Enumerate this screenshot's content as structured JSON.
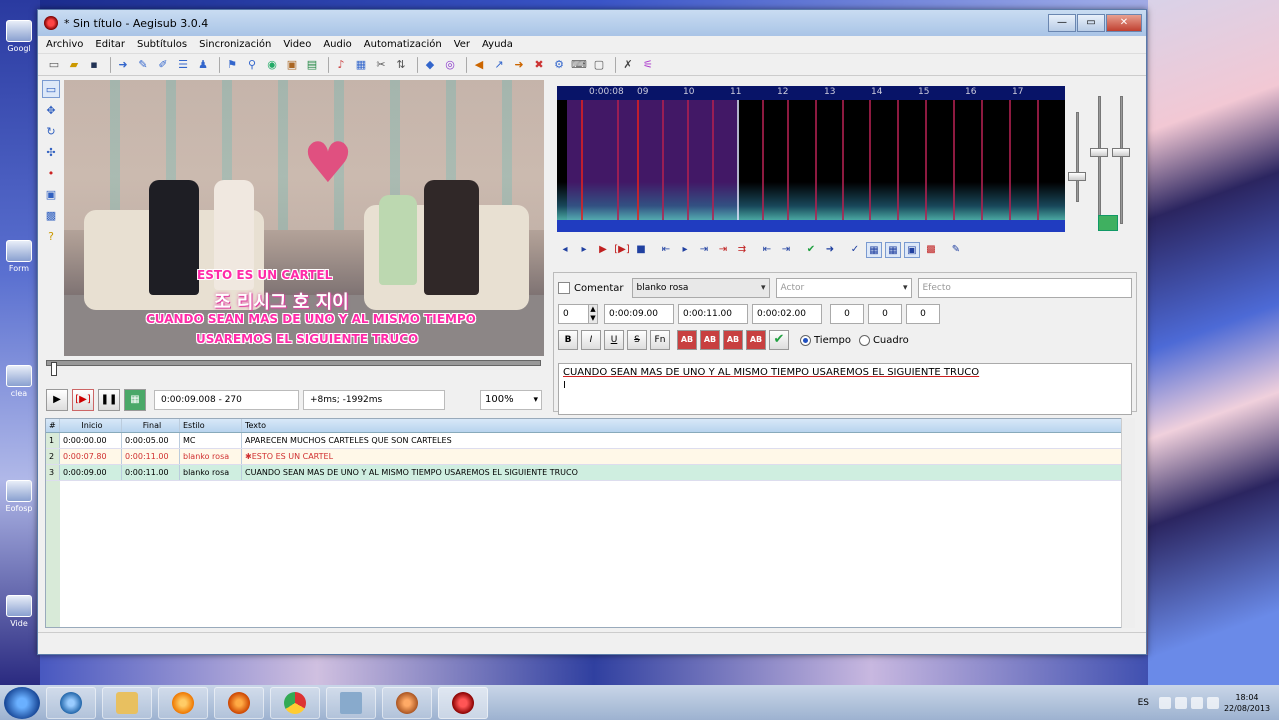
{
  "window": {
    "title": "* Sin título - Aegisub 3.0.4"
  },
  "desktop_icons": [
    "Googl",
    "Form",
    "clea",
    "Eofosp",
    "Vide"
  ],
  "menu": [
    "Archivo",
    "Editar",
    "Subtítulos",
    "Sincronización",
    "Video",
    "Audio",
    "Automatización",
    "Ver",
    "Ayuda"
  ],
  "video": {
    "subtitle_top": "ESTO  ES UN CARTEL",
    "subtitle_line1": "CUANDO SEAN MAS DE UNO Y AL MISMO TIEMPO",
    "subtitle_line2": "USAREMOS EL SIGUIENTE TRUCO",
    "korean_text": "조 리시그 호 지이",
    "time_display": "0:00:09.008 - 270",
    "offset_display": "+8ms; -1992ms",
    "zoom": "100%",
    "seek_progress": 0.01
  },
  "audio": {
    "ruler": [
      "0:00:08",
      "09",
      "10",
      "11",
      "12",
      "13",
      "14",
      "15",
      "16",
      "17"
    ]
  },
  "edit": {
    "comment_label": "Comentar",
    "style": "blanko rosa",
    "actor_placeholder": "Actor",
    "effect_placeholder": "Efecto",
    "layer": "0",
    "start": "0:00:09.00",
    "end": "0:00:11.00",
    "duration": "0:00:02.00",
    "margin_l": "0",
    "margin_r": "0",
    "margin_v": "0",
    "bold": "B",
    "italic": "I",
    "underline": "U",
    "strike": "S",
    "font": "Fn",
    "color_labels": [
      "AB",
      "AB",
      "AB",
      "AB"
    ],
    "time_label": "Tiempo",
    "frame_label": "Cuadro",
    "text": "CUANDO SEAN MAS DE UNO Y AL MISMO TIEMPO USAREMOS EL SIGUIENTE TRUCO"
  },
  "grid": {
    "headers": [
      "#",
      "Inicio",
      "Final",
      "Estilo",
      "Texto"
    ],
    "rows": [
      {
        "n": "1",
        "start": "0:00:00.00",
        "end": "0:00:05.00",
        "style": "MC",
        "text": "APARECEN MUCHOS CARTELES QUE SON CARTELES"
      },
      {
        "n": "2",
        "start": "0:00:07.80",
        "end": "0:00:11.00",
        "style": "blanko rosa",
        "text": "✱ESTO  ES UN CARTEL"
      },
      {
        "n": "3",
        "start": "0:00:09.00",
        "end": "0:00:11.00",
        "style": "blanko rosa",
        "text": "CUANDO SEAN MAS DE UNO Y AL MISMO TIEMPO USAREMOS EL SIGUIENTE TRUCO"
      }
    ]
  },
  "taskbar": {
    "lang": "ES",
    "time": "18:04",
    "date": "22/08/2013"
  },
  "colors": {
    "subtitle_pink": "#ff2aa8",
    "active_row": "#cfeee0",
    "selected_row_text": "#d03030"
  }
}
